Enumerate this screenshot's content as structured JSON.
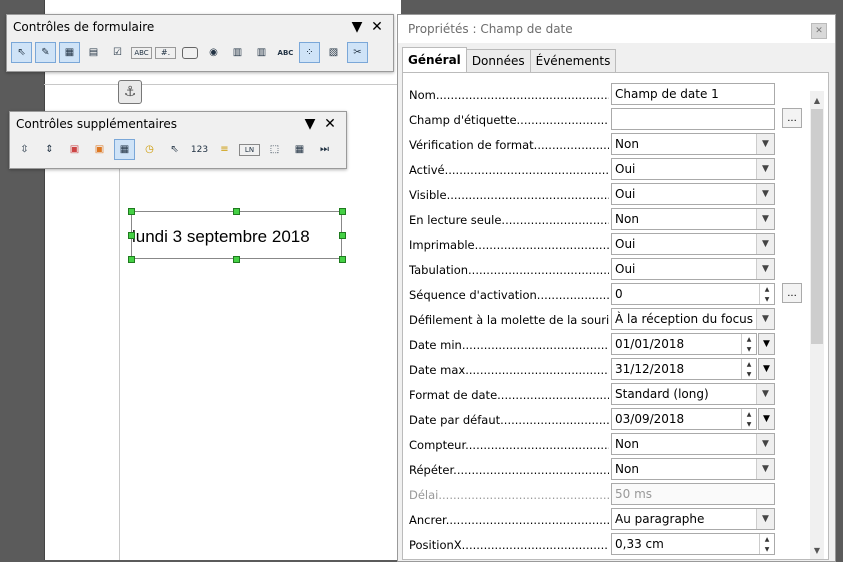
{
  "form_controls_toolbar": {
    "title": "Contrôles de formulaire",
    "icons": [
      "select-icon",
      "design-mode-icon",
      "control-wizard-icon",
      "form-design-icon",
      "checkbox-icon",
      "label-icon",
      "text-box-icon",
      "push-button-icon",
      "option-button-icon",
      "list-box-icon",
      "combo-box-icon",
      "text-label-icon",
      "group-box-icon",
      "form-navigator-icon",
      "activate-design-icon"
    ],
    "text_icon_labels": {
      "label": "ABC",
      "textbox": "#.",
      "abc2": "ABC"
    }
  },
  "more_controls_toolbar": {
    "title": "Contrôles supplémentaires",
    "numeric_label": "123",
    "ln_label": "LN"
  },
  "document": {
    "date_field_text": "lundi 3 septembre 2018"
  },
  "properties": {
    "title": "Propriétés : Champ de date",
    "tabs": [
      {
        "label": "Général",
        "active": true
      },
      {
        "label": "Données",
        "active": false
      },
      {
        "label": "Événements",
        "active": false
      }
    ],
    "rows": [
      {
        "label": "Nom.........................................................",
        "value": "Champ de date 1",
        "kind": "text"
      },
      {
        "label": "Champ d'étiquette.......................................",
        "value": "",
        "kind": "text-dots"
      },
      {
        "label": "Vérification de format..............................",
        "value": "Non",
        "kind": "dropdown"
      },
      {
        "label": "Activé..............................................",
        "value": "Oui",
        "kind": "dropdown"
      },
      {
        "label": "Visible.............................................",
        "value": "Oui",
        "kind": "dropdown"
      },
      {
        "label": "En lecture seule....................................",
        "value": "Non",
        "kind": "dropdown"
      },
      {
        "label": "Imprimable..........................................",
        "value": "Oui",
        "kind": "dropdown"
      },
      {
        "label": "Tabulation..........................................",
        "value": "Oui",
        "kind": "dropdown"
      },
      {
        "label": "Séquence d'activation...............................",
        "value": "0",
        "kind": "spin-dots"
      },
      {
        "label": "Défilement à la molette de la souris................",
        "value": "À la réception du focus",
        "kind": "dropdown"
      },
      {
        "label": "Date min............................................",
        "value": "01/01/2018",
        "kind": "spin-dd"
      },
      {
        "label": "Date max............................................",
        "value": "31/12/2018",
        "kind": "spin-dd"
      },
      {
        "label": "Format de date......................................",
        "value": "Standard (long)",
        "kind": "dropdown"
      },
      {
        "label": "Date par défaut.....................................",
        "value": "03/09/2018",
        "kind": "spin-dd"
      },
      {
        "label": "Compteur............................................",
        "value": "Non",
        "kind": "dropdown"
      },
      {
        "label": "Répéter.............................................",
        "value": "Non",
        "kind": "dropdown"
      },
      {
        "label": "Délai...............................................",
        "value": "50 ms",
        "kind": "disabled"
      },
      {
        "label": "Ancrer..............................................",
        "value": "Au paragraphe",
        "kind": "dropdown"
      },
      {
        "label": "PositionX...........................................",
        "value": "0,33 cm",
        "kind": "spin"
      }
    ]
  }
}
